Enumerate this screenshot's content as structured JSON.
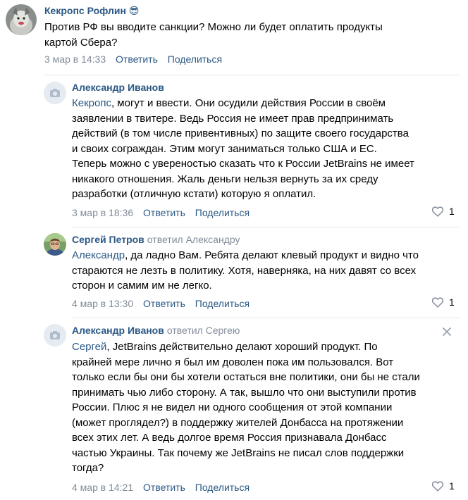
{
  "comments": [
    {
      "author": "Кекропс Рофлин",
      "emoji": "😎",
      "text_lines": [
        "Против РФ вы вводите санкции? Можно ли будет оплатить продукты",
        "картой Сбера?"
      ],
      "date": "3 мар в 14:33",
      "reply": "Ответить",
      "share": "Поделиться"
    },
    {
      "author": "Александр Иванов",
      "mention": "Кекропс",
      "text_lines": [
        ", могут и ввести. Они осудили действия России в своём",
        "заявлении в твитере. Ведь Россия не имеет прав предпринимать",
        "действий (в том числе привентивных) по защите своего государства",
        "и своих сограждан. Этим могут заниматься только США и ЕС.",
        "Теперь можно с увереностью сказать что к России JetBrains не имеет",
        "никакого отношения. Жаль деньги нельзя вернуть за их среду",
        "разработки (отличную кстати) которую я оплатил."
      ],
      "date": "3 мар в 18:36",
      "reply": "Ответить",
      "share": "Поделиться",
      "likes": "1"
    },
    {
      "author": "Сергей Петров",
      "replied_to": "ответил Александру",
      "mention": "Александр",
      "text_lines": [
        ", да ладно Вам. Ребята делают клевый продукт и видно что",
        "стараются не лезть в политику. Хотя, наверняка, на них давят со всех",
        "сторон и самим им не легко."
      ],
      "date": "4 мар в 13:30",
      "reply": "Ответить",
      "share": "Поделиться",
      "likes": "1"
    },
    {
      "author": "Александр Иванов",
      "replied_to": "ответил Сергею",
      "mention": "Сергей",
      "text_lines": [
        ", JetBrains действительно делают хороший продукт. По",
        "крайней мере лично я был им доволен пока им пользовался. Вот",
        "только если бы они бы хотели остаться вне политики, они бы не стали",
        "принимать чью либо сторону. А так, вышло что они выступили против",
        "России. Плюс я не видел ни одного сообщения от этой компании",
        "(может проглядел?) в поддержку жителей Донбасса на протяжении",
        "всех этих лет. А ведь долгое время Россия признавала Донбасс",
        "частью Украины. Так почему же JetBrains не писал слов поддержки",
        "тогда?"
      ],
      "date": "4 мар в 14:21",
      "reply": "Ответить",
      "share": "Поделиться",
      "likes": "1"
    }
  ],
  "colors": {
    "link": "#2a5885",
    "meta": "#818c99",
    "divider": "#e7e8ec",
    "heart": "#818c99"
  },
  "icons": [
    "camera-placeholder-icon",
    "heart-icon",
    "close-icon"
  ]
}
